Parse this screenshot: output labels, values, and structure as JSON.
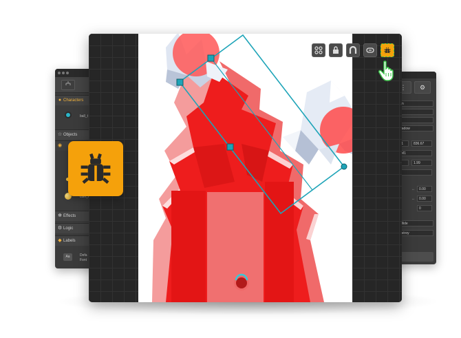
{
  "left_panel": {
    "sections": [
      {
        "label": "Characters",
        "icon": "person-icon"
      },
      {
        "label": "Objects",
        "icon": "star-icon"
      },
      {
        "label": "Effects",
        "icon": "effects-icon"
      },
      {
        "label": "Logic",
        "icon": "logic-icon"
      },
      {
        "label": "Labels",
        "icon": "tag-icon"
      }
    ],
    "items": [
      "ball_t",
      "coin_t",
      "Defa",
      "Font"
    ]
  },
  "right_panel": {
    "fields": [
      "rm",
      "",
      "",
      "hadow",
      "11",
      "836.67",
      "°M1",
      "1",
      "1.99",
      "",
      "0.00",
      "0.00",
      "0",
      "ollide",
      "estroy"
    ]
  },
  "toolbar": {
    "buttons": [
      {
        "name": "physics-joints-icon"
      },
      {
        "name": "lock-icon"
      },
      {
        "name": "magnet-icon"
      },
      {
        "name": "link-icon"
      },
      {
        "name": "bug-icon",
        "active": true
      }
    ]
  },
  "colors": {
    "accent": "#f5a10b",
    "scene_red": "#ee1d1d",
    "selection": "#1ea4b8",
    "panel": "#3b3b3b",
    "cursor_green": "#3cc34a"
  }
}
